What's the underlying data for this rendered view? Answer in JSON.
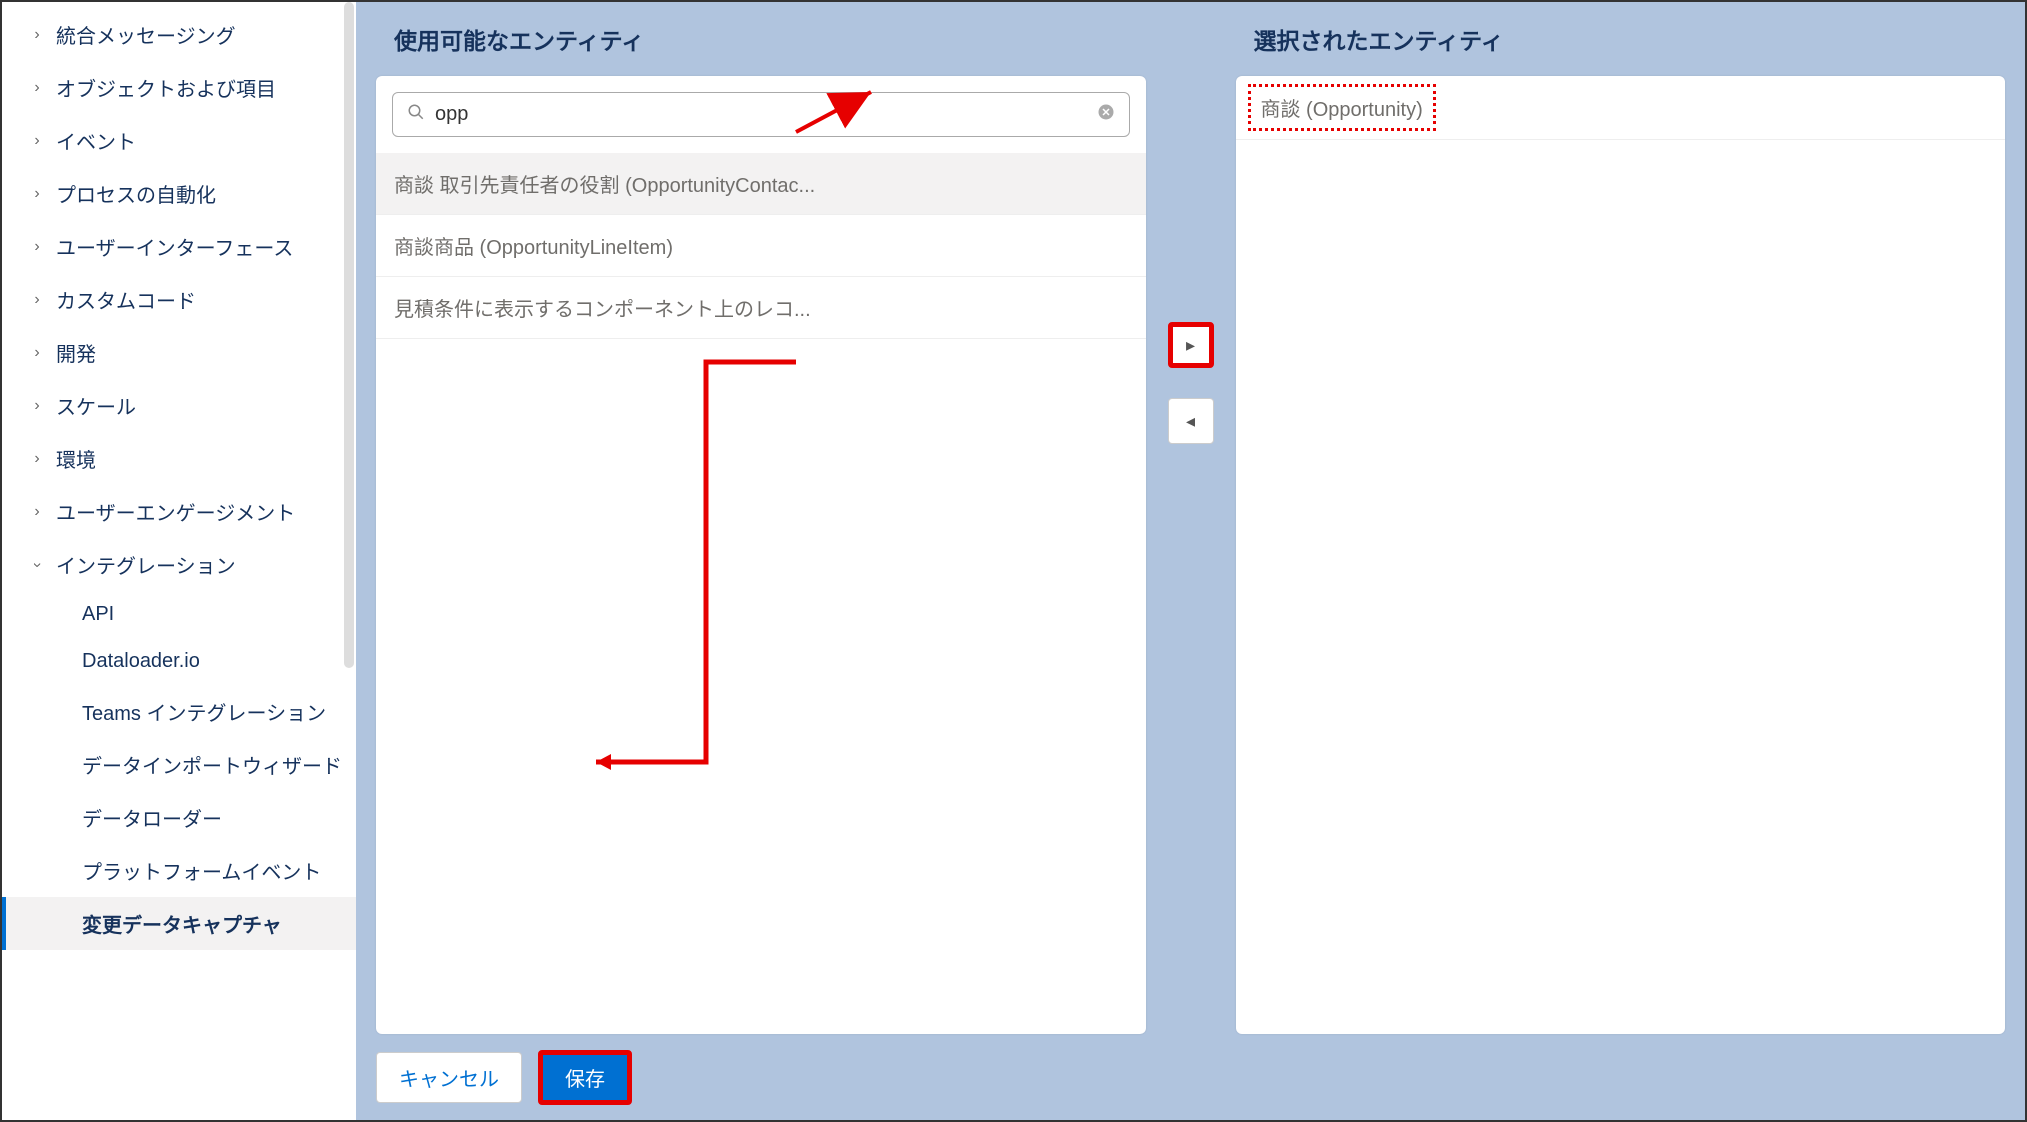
{
  "sidebar": {
    "items": [
      {
        "label": "統合メッセージング",
        "expanded": false
      },
      {
        "label": "オブジェクトおよび項目",
        "expanded": false
      },
      {
        "label": "イベント",
        "expanded": false
      },
      {
        "label": "プロセスの自動化",
        "expanded": false
      },
      {
        "label": "ユーザーインターフェース",
        "expanded": false
      },
      {
        "label": "カスタムコード",
        "expanded": false
      },
      {
        "label": "開発",
        "expanded": false
      },
      {
        "label": "スケール",
        "expanded": false
      },
      {
        "label": "環境",
        "expanded": false
      },
      {
        "label": "ユーザーエンゲージメント",
        "expanded": false
      },
      {
        "label": "インテグレーション",
        "expanded": true
      }
    ],
    "subitems": [
      {
        "label": "API"
      },
      {
        "label": "Dataloader.io"
      },
      {
        "label": "Teams インテグレーション"
      },
      {
        "label": "データインポートウィザード"
      },
      {
        "label": "データローダー"
      },
      {
        "label": "プラットフォームイベント"
      },
      {
        "label": "変更データキャプチャ",
        "active": true
      }
    ]
  },
  "available": {
    "title": "使用可能なエンティティ",
    "search_value": "opp",
    "items": [
      "商談 取引先責任者の役割 (OpportunityContac...",
      "商談商品 (OpportunityLineItem)",
      "見積条件に表示するコンポーネント上のレコ..."
    ]
  },
  "selected": {
    "title": "選択されたエンティティ",
    "items": [
      "商談 (Opportunity)"
    ]
  },
  "buttons": {
    "cancel": "キャンセル",
    "save": "保存"
  }
}
